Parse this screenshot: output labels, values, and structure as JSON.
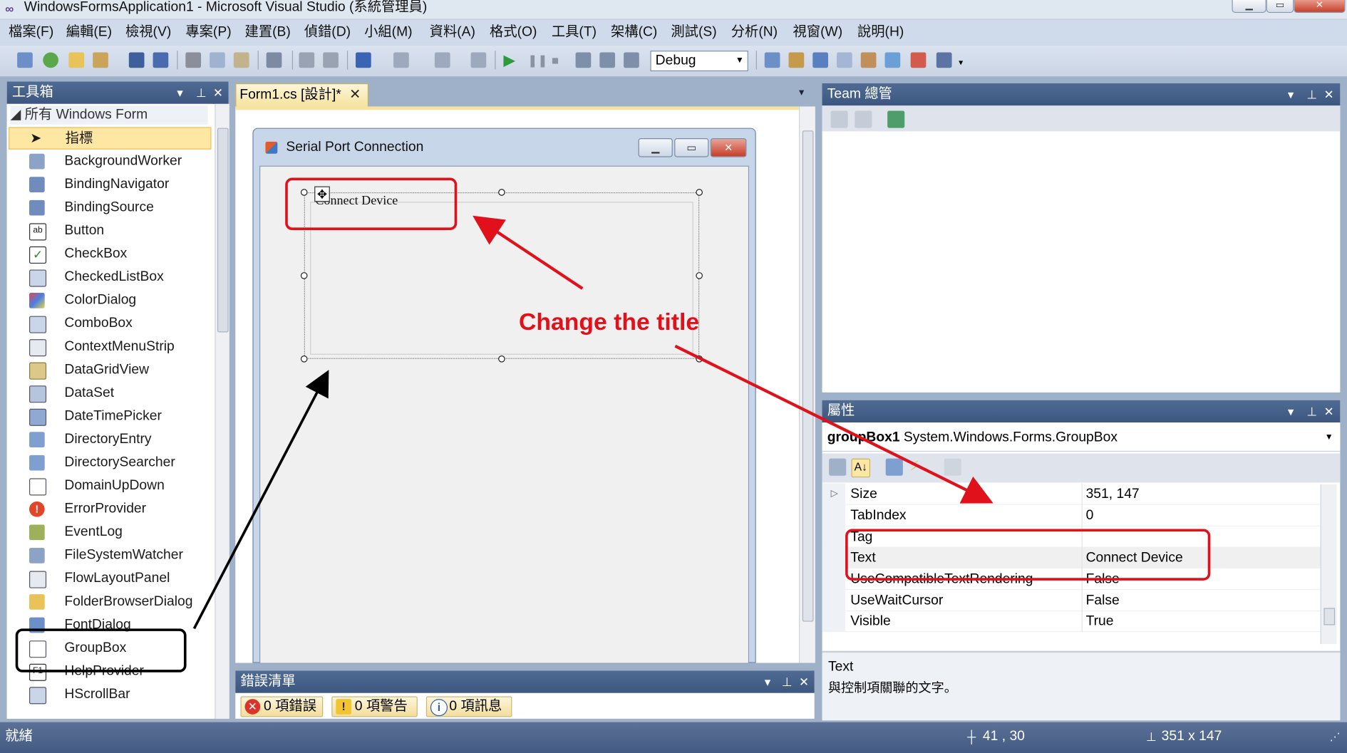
{
  "window": {
    "title": "WindowsFormsApplication1 - Microsoft Visual Studio (系統管理員)"
  },
  "menubar": {
    "items": [
      "檔案(F)",
      "編輯(E)",
      "檢視(V)",
      "專案(P)",
      "建置(B)",
      "偵錯(D)",
      "小組(M)",
      "資料(A)",
      "格式(O)",
      "工具(T)",
      "架構(C)",
      "測試(S)",
      "分析(N)",
      "視窗(W)",
      "說明(H)"
    ]
  },
  "toolbar": {
    "config_value": "Debug"
  },
  "toolbox": {
    "title": "工具箱",
    "category": "所有 Windows Form",
    "items": [
      "指標",
      "BackgroundWorker",
      "BindingNavigator",
      "BindingSource",
      "Button",
      "CheckBox",
      "CheckedListBox",
      "ColorDialog",
      "ComboBox",
      "ContextMenuStrip",
      "DataGridView",
      "DataSet",
      "DateTimePicker",
      "DirectoryEntry",
      "DirectorySearcher",
      "DomainUpDown",
      "ErrorProvider",
      "EventLog",
      "FileSystemWatcher",
      "FlowLayoutPanel",
      "FolderBrowserDialog",
      "FontDialog",
      "GroupBox",
      "HelpProvider",
      "HScrollBar"
    ]
  },
  "designer": {
    "tab_label": "Form1.cs [設計]*",
    "form_title": "Serial Port Connection",
    "groupbox_text": "Connect Device"
  },
  "error_list": {
    "title": "錯誤清單",
    "errors": "0 項錯誤",
    "warnings": "0 項警告",
    "messages": "0 項訊息"
  },
  "team": {
    "title": "Team 總管"
  },
  "properties": {
    "title": "屬性",
    "object_name": "groupBox1",
    "object_type": "System.Windows.Forms.GroupBox",
    "rows": [
      {
        "name": "Size",
        "value": "351, 147"
      },
      {
        "name": "TabIndex",
        "value": "0"
      },
      {
        "name": "Tag",
        "value": ""
      },
      {
        "name": "Text",
        "value": "Connect Device"
      },
      {
        "name": "UseCompatibleTextRendering",
        "value": "False"
      },
      {
        "name": "UseWaitCursor",
        "value": "False"
      },
      {
        "name": "Visible",
        "value": "True"
      }
    ],
    "desc_title": "Text",
    "desc_body": "與控制項關聯的文字。"
  },
  "statusbar": {
    "state": "就緒",
    "position": "41 , 30",
    "size": "351 x 147"
  },
  "annotation": {
    "text": "Change the title",
    "color": "#e0111a"
  }
}
